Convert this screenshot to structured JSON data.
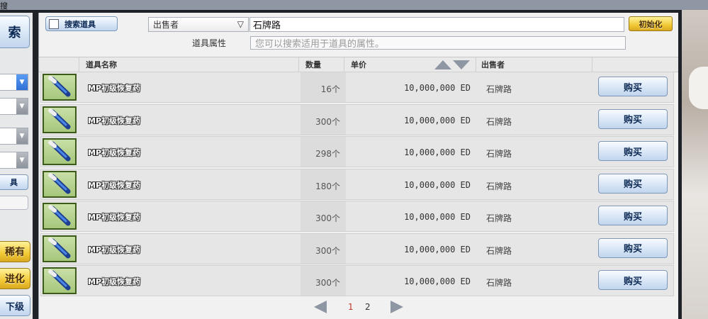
{
  "window": {
    "title_fragment": "搜"
  },
  "colors": {
    "accent_blue": "#2f6fd6",
    "gold": "#f2c935",
    "page_current": "#c0392b"
  },
  "left_panel": {
    "search_label": "索",
    "small_button_label": "具",
    "rare_label": "稀有",
    "evolve_label": "进化",
    "lower_label": "下级"
  },
  "search": {
    "checkbox_label": "搜索道具",
    "seller_select": "出售者",
    "seller_value": "石牌路",
    "reset_label": "初始化",
    "attr_label": "道具属性",
    "attr_placeholder": "您可以搜索适用于道具的属性。"
  },
  "table": {
    "headers": {
      "name": "道具名称",
      "qty": "数量",
      "price": "单价",
      "seller": "出售者"
    },
    "rows": [
      {
        "name": "MP初级恢复药",
        "qty": "16个",
        "price": "10,000,000 ED",
        "seller": "石牌路",
        "buy": "购买",
        "icon": "potion-icon"
      },
      {
        "name": "MP初级恢复药",
        "qty": "300个",
        "price": "10,000,000 ED",
        "seller": "石牌路",
        "buy": "购买",
        "icon": "potion-icon"
      },
      {
        "name": "MP初级恢复药",
        "qty": "298个",
        "price": "10,000,000 ED",
        "seller": "石牌路",
        "buy": "购买",
        "icon": "potion-icon"
      },
      {
        "name": "MP初级恢复药",
        "qty": "180个",
        "price": "10,000,000 ED",
        "seller": "石牌路",
        "buy": "购买",
        "icon": "potion-icon"
      },
      {
        "name": "MP初级恢复药",
        "qty": "300个",
        "price": "10,000,000 ED",
        "seller": "石牌路",
        "buy": "购买",
        "icon": "potion-icon"
      },
      {
        "name": "MP初级恢复药",
        "qty": "300个",
        "price": "10,000,000 ED",
        "seller": "石牌路",
        "buy": "购买",
        "icon": "potion-icon"
      },
      {
        "name": "MP初级恢复药",
        "qty": "300个",
        "price": "10,000,000 ED",
        "seller": "石牌路",
        "buy": "购买",
        "icon": "potion-icon"
      }
    ]
  },
  "pager": {
    "pages": [
      "1",
      "2"
    ],
    "current": "1"
  }
}
